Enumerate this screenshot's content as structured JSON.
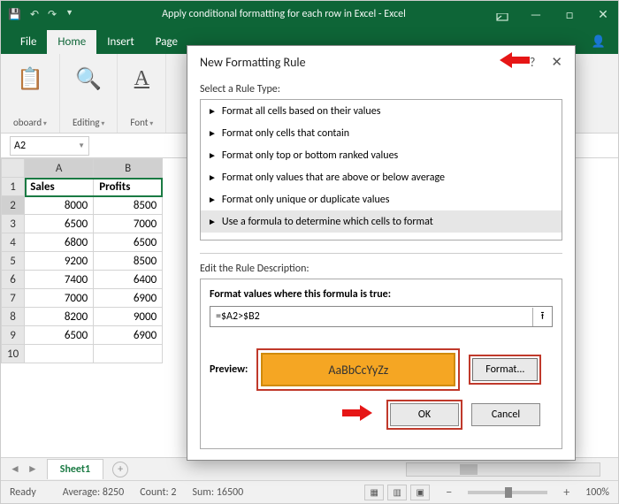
{
  "titlebar": {
    "title": "Apply conditional formatting for each row in Excel  -  Excel"
  },
  "tabs": {
    "file": "File",
    "home": "Home",
    "insert": "Insert",
    "page": "Page"
  },
  "ribbon": {
    "clipboard": "oboard",
    "editing": "Editing",
    "font": "Font"
  },
  "namebox": "A2",
  "grid": {
    "colA": "A",
    "colB": "B",
    "headers": {
      "a": "Sales",
      "b": "Profits"
    },
    "rows": [
      {
        "n": "1"
      },
      {
        "n": "2",
        "a": "8000",
        "b": "8500"
      },
      {
        "n": "3",
        "a": "6500",
        "b": "7000"
      },
      {
        "n": "4",
        "a": "6800",
        "b": "6500"
      },
      {
        "n": "5",
        "a": "9200",
        "b": "8500"
      },
      {
        "n": "6",
        "a": "7400",
        "b": "6400"
      },
      {
        "n": "7",
        "a": "7000",
        "b": "6900"
      },
      {
        "n": "8",
        "a": "8200",
        "b": "9000"
      },
      {
        "n": "9",
        "a": "6500",
        "b": "6900"
      },
      {
        "n": "10"
      }
    ]
  },
  "sheet": {
    "name": "Sheet1"
  },
  "status": {
    "ready": "Ready",
    "average": "Average: 8250",
    "count": "Count: 2",
    "sum": "Sum: 16500",
    "zoom": "100%"
  },
  "dialog": {
    "title": "New Formatting Rule",
    "select_label": "Select a Rule Type:",
    "rule_types": [
      "Format all cells based on their values",
      "Format only cells that contain",
      "Format only top or bottom ranked values",
      "Format only values that are above or below average",
      "Format only unique or duplicate values",
      "Use a formula to determine which cells to format"
    ],
    "edit_label": "Edit the Rule Description:",
    "formula_label": "Format values where this formula is true:",
    "formula_value": "=$A2>$B2",
    "preview_label": "Preview:",
    "preview_text": "AaBbCcYyZz",
    "format_btn": "Format...",
    "ok": "OK",
    "cancel": "Cancel"
  }
}
